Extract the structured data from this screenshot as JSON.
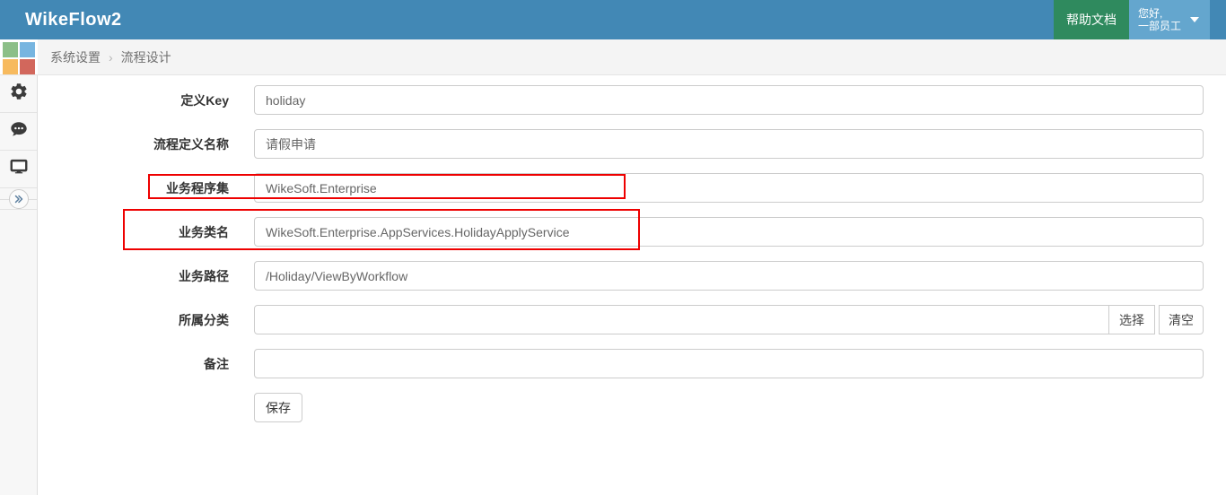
{
  "header": {
    "title": "WikeFlow2",
    "help_button_label": "帮助文档",
    "user_greeting_line1": "您好,",
    "user_greeting_line2": "一部员工",
    "colors": {
      "header_bg": "#4288b5",
      "help_button_bg": "#2f8a5e",
      "user_menu_bg": "#64a6ce"
    }
  },
  "sidebar": {
    "logo_colors": [
      "#8cbf88",
      "#77b5e0",
      "#f7ba5e",
      "#d2675c"
    ],
    "icons": [
      "settings-gear",
      "chat-bubble",
      "monitor",
      "collapse-double-chevron"
    ]
  },
  "breadcrumb": {
    "items": [
      "系统设置",
      "流程设计"
    ],
    "separator": "›"
  },
  "form": {
    "fields": [
      {
        "label": "定义Key",
        "value": "holiday"
      },
      {
        "label": "流程定义名称",
        "value": "请假申请"
      },
      {
        "label": "业务程序集",
        "value": "WikeSoft.Enterprise"
      },
      {
        "label": "业务类名",
        "value": "WikeSoft.Enterprise.AppServices.HolidayApplyService"
      },
      {
        "label": "业务路径",
        "value": "/Holiday/ViewByWorkflow"
      },
      {
        "label": "所属分类",
        "value": ""
      },
      {
        "label": "备注",
        "value": ""
      }
    ],
    "category_select_button": "选择",
    "category_clear_button": "清空",
    "save_button": "保存"
  },
  "annotations": {
    "color": "#ee0000",
    "boxes": [
      {
        "around": "业务程序集"
      },
      {
        "around": "业务类名"
      }
    ]
  }
}
